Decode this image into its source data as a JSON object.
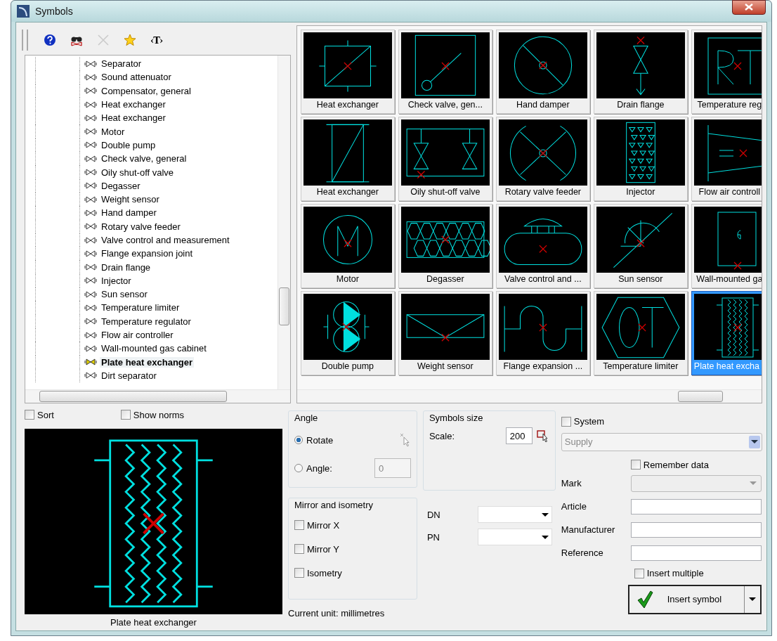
{
  "window": {
    "title": "Symbols"
  },
  "toolbar": [
    {
      "kind": "help",
      "disabled": false
    },
    {
      "kind": "find",
      "disabled": false
    },
    {
      "kind": "delete",
      "disabled": true
    },
    {
      "kind": "favorite",
      "disabled": false
    },
    {
      "kind": "tag",
      "label": "‹T›",
      "disabled": false
    }
  ],
  "tree": {
    "items": [
      {
        "label": "Separator",
        "selected": false
      },
      {
        "label": "Sound attenuator",
        "selected": false
      },
      {
        "label": "Compensator, general",
        "selected": false
      },
      {
        "label": "Heat exchanger",
        "selected": false
      },
      {
        "label": "Heat exchanger",
        "selected": false
      },
      {
        "label": "Motor",
        "selected": false
      },
      {
        "label": "Double pump",
        "selected": false
      },
      {
        "label": "Check valve, general",
        "selected": false
      },
      {
        "label": "Oily shut-off valve",
        "selected": false
      },
      {
        "label": "Degasser",
        "selected": false
      },
      {
        "label": "Weight sensor",
        "selected": false
      },
      {
        "label": "Hand damper",
        "selected": false
      },
      {
        "label": "Rotary valve feeder",
        "selected": false
      },
      {
        "label": "Valve control and measurement",
        "selected": false
      },
      {
        "label": "Flange expansion joint",
        "selected": false
      },
      {
        "label": "Drain flange",
        "selected": false
      },
      {
        "label": "Injector",
        "selected": false
      },
      {
        "label": "Sun sensor",
        "selected": false
      },
      {
        "label": "Temperature limiter",
        "selected": false
      },
      {
        "label": "Temperature regulator",
        "selected": false
      },
      {
        "label": "Flow air controller",
        "selected": false
      },
      {
        "label": "Wall-mounted gas cabinet",
        "selected": false
      },
      {
        "label": "Plate heat exchanger",
        "selected": true
      },
      {
        "label": "Dirt separator",
        "selected": false
      }
    ]
  },
  "gallery": {
    "tiles": [
      {
        "label": "Heat exchanger",
        "kind": "crossbox",
        "selected": false
      },
      {
        "label": "Check valve, gen...",
        "kind": "checkvalve",
        "selected": false
      },
      {
        "label": "Hand damper",
        "kind": "damper",
        "selected": false
      },
      {
        "label": "Drain flange",
        "kind": "drain",
        "selected": false
      },
      {
        "label": "Temperature reg",
        "kind": "regulator",
        "selected": false
      },
      {
        "label": "Heat exchanger",
        "kind": "diagbox",
        "selected": false
      },
      {
        "label": "Oily shut-off valve",
        "kind": "twovalves",
        "selected": false
      },
      {
        "label": "Rotary valve feeder",
        "kind": "rotary",
        "selected": false
      },
      {
        "label": "Injector",
        "kind": "injector",
        "selected": false
      },
      {
        "label": "Flow air controll",
        "kind": "flow",
        "selected": false
      },
      {
        "label": "Motor",
        "kind": "motor",
        "selected": false
      },
      {
        "label": "Degasser",
        "kind": "hex",
        "selected": false
      },
      {
        "label": "Valve control and ...",
        "kind": "tank",
        "selected": false
      },
      {
        "label": "Sun sensor",
        "kind": "sun",
        "selected": false
      },
      {
        "label": "Wall-mounted ga",
        "kind": "cabinet",
        "selected": false
      },
      {
        "label": "Double pump",
        "kind": "pump",
        "selected": false
      },
      {
        "label": "Weight sensor",
        "kind": "weight",
        "selected": false
      },
      {
        "label": "Flange expansion ...",
        "kind": "loop",
        "selected": false
      },
      {
        "label": "Temperature limiter",
        "kind": "limiter",
        "selected": false
      },
      {
        "label": "Plate heat excha",
        "kind": "plate",
        "selected": true
      }
    ]
  },
  "list_options": [
    {
      "label": "Sort",
      "checked": false
    },
    {
      "label": "Show norms",
      "checked": false
    }
  ],
  "preview": {
    "kind": "plate",
    "caption": "Plate heat exchanger"
  },
  "angle": {
    "title": "Angle",
    "options": [
      {
        "label": "Rotate",
        "selected": true
      },
      {
        "label": "Angle:",
        "selected": false
      }
    ],
    "value": "0",
    "disabled": true
  },
  "mirror": {
    "title": "Mirror and isometry",
    "options": [
      {
        "label": "Mirror X",
        "checked": false
      },
      {
        "label": "Mirror Y",
        "checked": false
      },
      {
        "label": "Isometry",
        "checked": false
      }
    ]
  },
  "unit": "Current unit: millimetres",
  "size": {
    "title": "Symbols size",
    "label": "Scale:",
    "value": "200"
  },
  "pipe": [
    {
      "label": "DN"
    },
    {
      "label": "PN"
    }
  ],
  "system": {
    "label": "System",
    "checked": false,
    "value": "Supply",
    "disabled": true
  },
  "remember": {
    "label": "Remember data",
    "checked": false
  },
  "fields": [
    {
      "label": "Mark",
      "kind": "dropdown",
      "disabled": true
    },
    {
      "label": "Article",
      "kind": "text",
      "disabled": false
    },
    {
      "label": "Manufacturer",
      "kind": "text",
      "disabled": false
    },
    {
      "label": "Reference",
      "kind": "text",
      "disabled": false
    }
  ],
  "insert_multiple": {
    "label": "Insert multiple",
    "checked": false
  },
  "insert_button": {
    "label": "Insert symbol"
  }
}
